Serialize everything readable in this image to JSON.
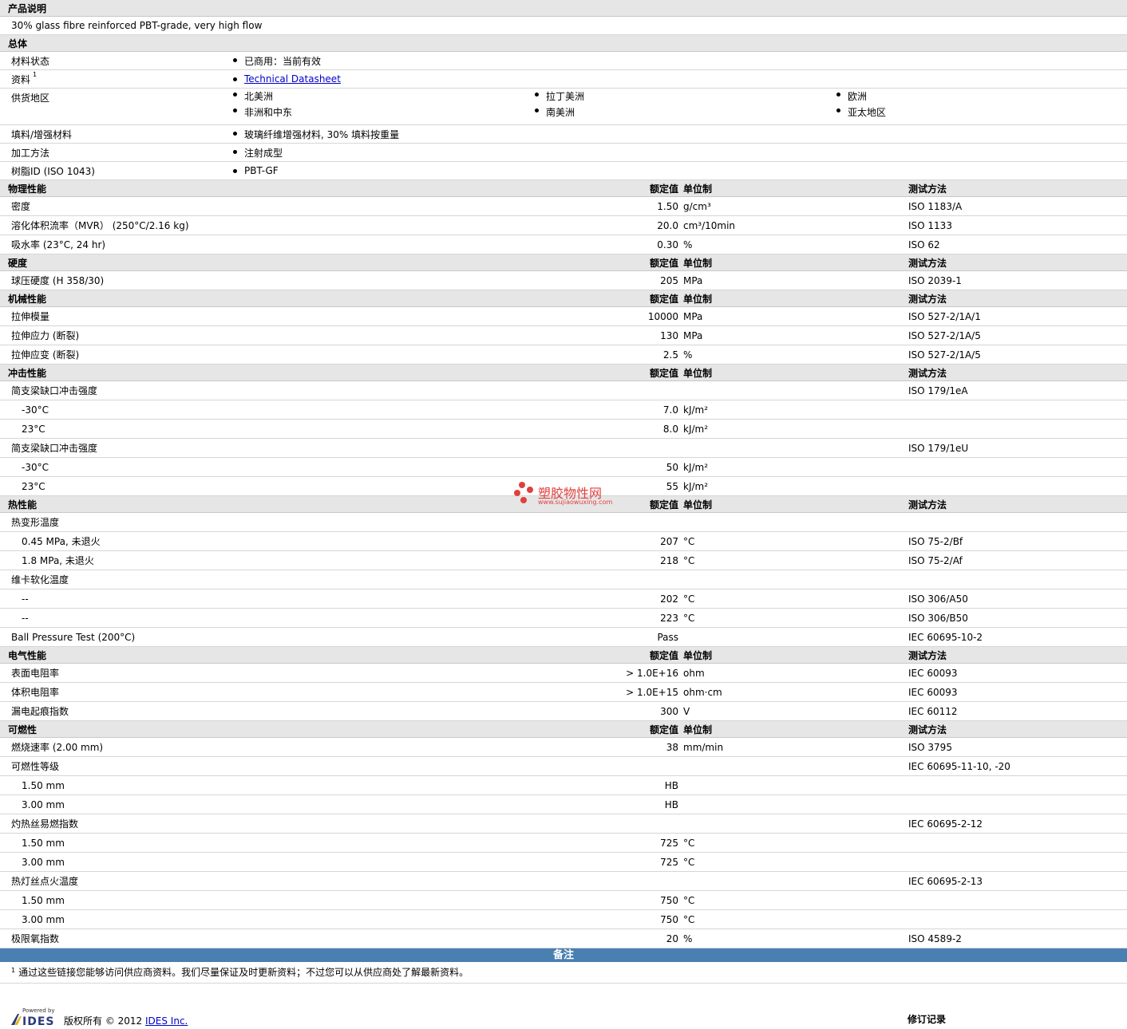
{
  "desc": {
    "title": "产品说明",
    "text": "30% glass fibre reinforced PBT-grade, very high flow"
  },
  "general": {
    "title": "总体",
    "status_label": "材料状态",
    "status_value": "已商用：当前有效",
    "docs_label": "资料",
    "docs_sup": "1",
    "docs_link": "Technical Datasheet",
    "supply_label": "供货地区",
    "regions": [
      "北美洲",
      "拉丁美洲",
      "欧洲",
      "非洲和中东",
      "南美洲",
      "亚太地区"
    ],
    "filler_label": "填料/增强材料",
    "filler_value": "玻璃纤维增强材料, 30% 填料按重量",
    "process_label": "加工方法",
    "process_value": "注射成型",
    "resin_label": "树脂ID (ISO 1043)",
    "resin_value": "PBT-GF"
  },
  "headers": {
    "value": "额定值",
    "unit": "单位制",
    "method": "测试方法"
  },
  "sections": {
    "physical": "物理性能",
    "hardness": "硬度",
    "mechanical": "机械性能",
    "impact": "冲击性能",
    "thermal": "热性能",
    "electrical": "电气性能",
    "flammability": "可燃性"
  },
  "rows": [
    {
      "label": "密度",
      "value": "1.50",
      "unit": "g/cm³",
      "method": "ISO 1183/A"
    },
    {
      "label": "溶化体积流率（MVR） (250°C/2.16 kg)",
      "value": "20.0",
      "unit": "cm³/10min",
      "method": "ISO 1133"
    },
    {
      "label": "吸水率 (23°C, 24 hr)",
      "value": "0.30",
      "unit": "%",
      "method": "ISO 62"
    },
    {
      "label": "球压硬度 (H 358/30)",
      "value": "205",
      "unit": "MPa",
      "method": "ISO 2039-1"
    },
    {
      "label": "拉伸模量",
      "value": "10000",
      "unit": "MPa",
      "method": "ISO 527-2/1A/1"
    },
    {
      "label": "拉伸应力 (断裂)",
      "value": "130",
      "unit": "MPa",
      "method": "ISO 527-2/1A/5"
    },
    {
      "label": "拉伸应变 (断裂)",
      "value": "2.5",
      "unit": "%",
      "method": "ISO 527-2/1A/5"
    },
    {
      "label": "简支梁缺口冲击强度",
      "value": "",
      "unit": "",
      "method": "ISO 179/1eA"
    },
    {
      "label": "-30°C",
      "value": "7.0",
      "unit": "kJ/m²",
      "method": ""
    },
    {
      "label": "23°C",
      "value": "8.0",
      "unit": "kJ/m²",
      "method": ""
    },
    {
      "label": "简支梁缺口冲击强度",
      "value": "",
      "unit": "",
      "method": "ISO 179/1eU"
    },
    {
      "label": "-30°C",
      "value": "50",
      "unit": "kJ/m²",
      "method": ""
    },
    {
      "label": "23°C",
      "value": "55",
      "unit": "kJ/m²",
      "method": ""
    },
    {
      "label": "热变形温度",
      "value": "",
      "unit": "",
      "method": ""
    },
    {
      "label": "0.45 MPa, 未退火",
      "value": "207",
      "unit": "°C",
      "method": "ISO 75-2/Bf"
    },
    {
      "label": "1.8 MPa, 未退火",
      "value": "218",
      "unit": "°C",
      "method": "ISO 75-2/Af"
    },
    {
      "label": "维卡软化温度",
      "value": "",
      "unit": "",
      "method": ""
    },
    {
      "label": "--",
      "value": "202",
      "unit": "°C",
      "method": "ISO 306/A50"
    },
    {
      "label": "--",
      "value": "223",
      "unit": "°C",
      "method": "ISO 306/B50"
    },
    {
      "label": "Ball Pressure Test (200°C)",
      "value": "Pass",
      "unit": "",
      "method": "IEC 60695-10-2"
    },
    {
      "label": "表面电阻率",
      "value": "> 1.0E+16",
      "unit": "ohm",
      "method": "IEC 60093"
    },
    {
      "label": "体积电阻率",
      "value": "> 1.0E+15",
      "unit": "ohm·cm",
      "method": "IEC 60093"
    },
    {
      "label": "漏电起痕指数",
      "value": "300",
      "unit": "V",
      "method": "IEC 60112"
    },
    {
      "label": "燃烧速率 (2.00 mm)",
      "value": "38",
      "unit": "mm/min",
      "method": "ISO 3795"
    },
    {
      "label": "可燃性等级",
      "value": "",
      "unit": "",
      "method": "IEC 60695-11-10, -20"
    },
    {
      "label": "1.50 mm",
      "value": "HB",
      "unit": "",
      "method": ""
    },
    {
      "label": "3.00 mm",
      "value": "HB",
      "unit": "",
      "method": ""
    },
    {
      "label": "灼热丝易燃指数",
      "value": "",
      "unit": "",
      "method": "IEC 60695-2-12"
    },
    {
      "label": "1.50 mm",
      "value": "725",
      "unit": "°C",
      "method": ""
    },
    {
      "label": "3.00 mm",
      "value": "725",
      "unit": "°C",
      "method": ""
    },
    {
      "label": "热灯丝点火温度",
      "value": "",
      "unit": "",
      "method": "IEC 60695-2-13"
    },
    {
      "label": "1.50 mm",
      "value": "750",
      "unit": "°C",
      "method": ""
    },
    {
      "label": "3.00 mm",
      "value": "750",
      "unit": "°C",
      "method": ""
    },
    {
      "label": "极限氧指数",
      "value": "20",
      "unit": "%",
      "method": "ISO 4589-2"
    }
  ],
  "notes": {
    "title": "备注",
    "sup": "1",
    "text": "通过这些链接您能够访问供应商资料。我们尽量保证及时更新资料；不过您可以从供应商处了解最新资料。"
  },
  "footer": {
    "powered_by": "Powered by",
    "logo": "IDES",
    "copyright": "版权所有 © 2012",
    "company": "IDES Inc.",
    "revision": "修订记录"
  },
  "watermark": {
    "text": "塑胶物性网",
    "url": "www.sujiaowuxing.com",
    "color": "#e0403f"
  }
}
